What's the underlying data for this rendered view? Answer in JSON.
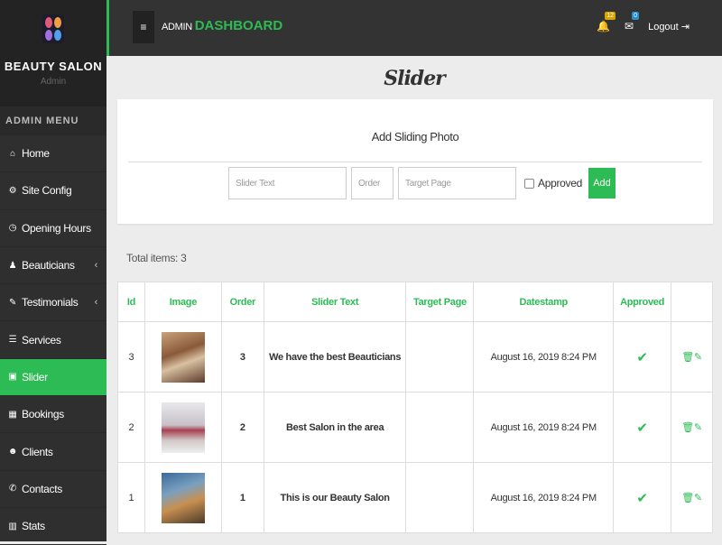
{
  "brand": {
    "name": "BEAUTY SALON",
    "subtitle": "Admin",
    "logo_colors": [
      "#e05a7a",
      "#f0a040",
      "#a070e0",
      "#50a0f0"
    ]
  },
  "menu": {
    "heading": "ADMIN MENU",
    "items": [
      {
        "label": "Home",
        "icon": "home-icon",
        "glyph": "⌂"
      },
      {
        "label": "Site Config",
        "icon": "gear-icon",
        "glyph": "⚙"
      },
      {
        "label": "Opening Hours",
        "icon": "clock-icon",
        "glyph": "◷"
      },
      {
        "label": "Beauticians",
        "icon": "person-icon",
        "glyph": "♟",
        "chevron": "‹"
      },
      {
        "label": "Testimonials",
        "icon": "comment-icon",
        "glyph": "✎",
        "chevron": "‹"
      },
      {
        "label": "Services",
        "icon": "list-icon",
        "glyph": "☰"
      },
      {
        "label": "Slider",
        "icon": "image-icon",
        "glyph": "▣",
        "active": true
      },
      {
        "label": "Bookings",
        "icon": "calendar-icon",
        "glyph": "▦"
      },
      {
        "label": "Clients",
        "icon": "users-icon",
        "glyph": "☻"
      },
      {
        "label": "Contacts",
        "icon": "phone-icon",
        "glyph": "✆"
      },
      {
        "label": "Stats",
        "icon": "chart-icon",
        "glyph": "▥"
      }
    ]
  },
  "topbar": {
    "menu_glyph": "≡",
    "title_prefix": "ADMIN",
    "title_main": "DASHBOARD",
    "notifications": "12",
    "messages": "0",
    "logout": "Logout ⇥"
  },
  "page": {
    "title": "Slider"
  },
  "form": {
    "heading": "Add Sliding Photo",
    "slider_text_placeholder": "Slider Text",
    "order_placeholder": "Order",
    "target_placeholder": "Target Page",
    "approved_label": "Approved",
    "add_label": "Add"
  },
  "table": {
    "total": "Total items: 3",
    "columns": [
      "Id",
      "Image",
      "Order",
      "Slider Text",
      "Target Page",
      "Datestamp",
      "Approved",
      ""
    ],
    "rows": [
      {
        "id": "3",
        "order": "3",
        "text": "We have the best Beauticians",
        "target": "",
        "date": "August 16, 2019 8:24 PM",
        "approved": "✔",
        "actions": "🗑✎"
      },
      {
        "id": "2",
        "order": "2",
        "text": "Best Salon in the area",
        "target": "",
        "date": "August 16, 2019 8:24 PM",
        "approved": "✔",
        "actions": "🗑✎"
      },
      {
        "id": "1",
        "order": "1",
        "text": "This is our Beauty Salon",
        "target": "",
        "date": "August 16, 2019 8:24 PM",
        "approved": "✔",
        "actions": "🗑✎"
      }
    ]
  },
  "colors": {
    "accent": "#2dbb55",
    "sidebar": "#2f2f2f",
    "topbar": "#333333"
  }
}
